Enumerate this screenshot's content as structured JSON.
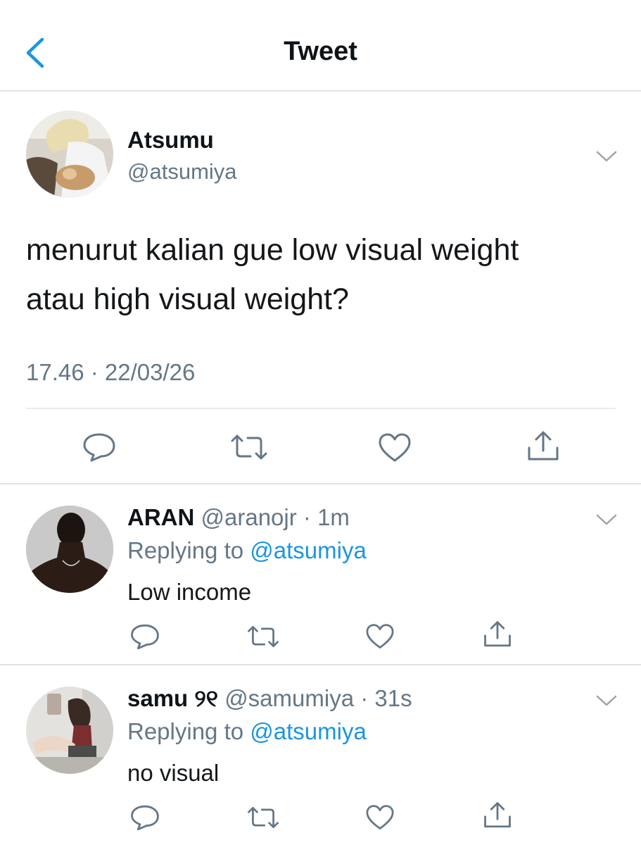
{
  "header": {
    "title": "Tweet",
    "back_icon": "chevron-left-icon",
    "accent": "#1b95e0"
  },
  "tweet": {
    "name": "Atsumu",
    "handle": "@atsumiya",
    "text_line1": "menurut kalian gue low visual weight",
    "text_line2": "atau high visual weight?",
    "timestamp": "17.46 · 22/03/26",
    "actions": [
      "reply-icon",
      "retweet-icon",
      "like-icon",
      "share-icon"
    ]
  },
  "replies": [
    {
      "name": "ARAN",
      "handle": "@aranojr",
      "time": "· 1m",
      "replying_label": "Replying to",
      "replying_to": "@atsumiya",
      "text": "Low income"
    },
    {
      "name": "samu ୨୧",
      "handle": "@samumiya",
      "time": "· 31s",
      "replying_label": "Replying to",
      "replying_to": "@atsumiya",
      "text": "no visual"
    }
  ]
}
